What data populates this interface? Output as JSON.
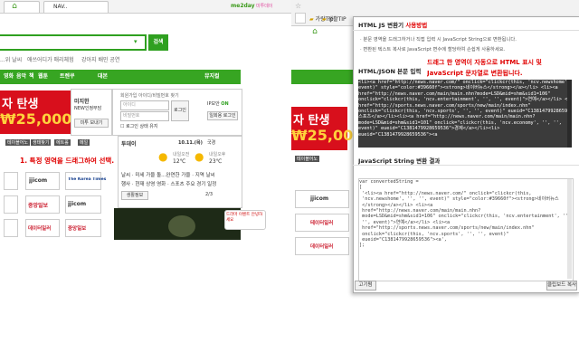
{
  "left": {
    "tab1": "",
    "tab2": "NAV..",
    "toolbar_links": [
      "me2day",
      "미투데이"
    ],
    "search_button": "검색",
    "below_search": [
      "...위 날씨",
      "애쓰어디가 매리체험",
      "강아지 배민 공연"
    ],
    "nav_items": [
      "영화",
      "음악",
      "책",
      "웹툰",
      "트렌쿠",
      "대본"
    ],
    "nav_right": "뮤지컬",
    "banner_line1": "자 탄생",
    "banner_line2": "₩25,000",
    "login": {
      "id_label": "회원가입 아이디/비밀번호 찾기",
      "id_placeholder": "아이디",
      "pw_placeholder": "비밀번호",
      "login_button": "로그인",
      "ip_label": "IP보안",
      "ip_status": "ON",
      "keep_login": "로그인 상태 유지",
      "one_time": "일회용 로그인",
      "profile_name": "미지한",
      "profile_sub": "NEW인정부담",
      "my_btn": "미투 보내기"
    },
    "tags": [
      "테이블어노",
      "생태찾기",
      "에트롤",
      "메일"
    ],
    "instruction": "1. 특정 영역을 드래그하여 선택.",
    "weather": {
      "title": "투데이",
      "date": "10.11.(목)",
      "region": "국경",
      "c1_label": "내일오전",
      "c1_temp": "12℃",
      "c2_label": "내일오후",
      "c2_temp": "23℃"
    },
    "info_rows": [
      "날씨 · 미세 가을 돌...완연한 가을 · 지역 날씨",
      "행사 · 현재 상영 영화 · 스포츠 주요 경기 일정"
    ],
    "select": "생활정보",
    "pager": "2/3",
    "news_logos": [
      "jjicom",
      "The Korea Times",
      "aT",
      "jjicom",
      "데이터일러",
      "중앙일보",
      "중앙일보",
      "테이터일러",
      "데이터일러"
    ],
    "video_caption": "드라마 이벤트 안녕하세요"
  },
  "right": {
    "tab_links": [
      "가랑Tip",
      "생활TIP"
    ],
    "popup": {
      "title_prefix": "HTML JS 변환기",
      "title_suffix": "사용방법",
      "bullet1": "· 분문 영역을 드래그하거나 직접 입력 시 JavaScript String으로 변환됩니다.",
      "bullet2": "· 변환된 텍스트 복사로 JavaScript 변수에 할당하여 손쉽게 사용하세요.",
      "red_line1": "드래그 한 영역이 자동으로 HTML 표시 및",
      "red_line2": "JavaScript 문자열로 변환됩니다.",
      "section1": "HTML/JSON 본문 입력",
      "source_code": "<li><a href=\"http://news.naver.com/\" onclick=\"clickcr(this, 'ncv.newshome', '', '',\nevent)\" style=\"color:#39660f\"><strong>네이버뉴스</strong></a></li> <li><a\nhref=\"http://news.naver.com/main/main.nhn?mode=LSD&mid=shm&sid1=106\"\nonclick=\"clickcr(this, 'ncv.entertainment', '', '', event)\">연예</a></li> <li><a\nhref=\"http://sports.news.naver.com/sports/new/main/index.nhn\"\nonclick=\"clickcr(this, 'ncv.sports', '', '', event)\" eueid=\"C1381479928659536\">\n스포츠</a></li><li><a href=\"http://news.naver.com/main/main.nhn?\nmode=LSD&mid=shm&sid1=101\" onclick=\"clickcr(this, 'ncv.economy', '', '',\nevent)\" eueid=\"C1381479928659536\">경제</a></li><li>\neueid=\"C1381479928659536\"><a",
      "section2": "JavaScript String 변환 결과",
      "result_code": "var convertedString =\n[\n '<li><a href=\"http://news.naver.com/\" onclick=\"clickcr(this,\n 'ncv.newshome', '', '', event)\" style=\"color:#39660f\"><strong>네이버뉴스\n </strong></a></li> <li><a\n href=\"http://news.naver.com/main/main.nhn?\n mode=LSD&mid=shm&sid1=106\" onclick=\"clickcr(this, 'ncv.entertainment', '',\n '', event)\">연예</a></li> <li><a\n href=\"http://sports.news.naver.com/sports/new/main/index.nhn\"\n onclick=\"clickcr(this, 'ncv.sports', '', '', event)\"\n eueid=\"C1381479928659536\"><a',\n];",
      "copy_button": "고기펌",
      "clipboard_button": "클립보드 복사"
    }
  }
}
